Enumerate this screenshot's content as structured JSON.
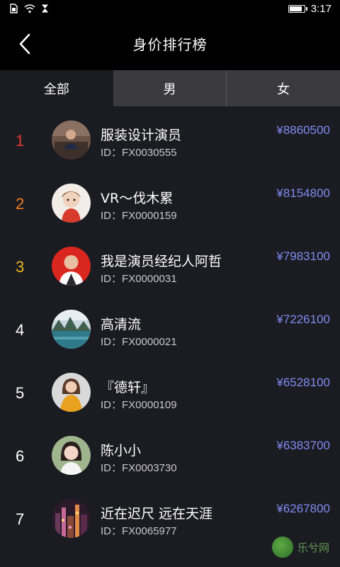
{
  "status_bar": {
    "time": "3:17"
  },
  "header": {
    "title": "身价排行榜"
  },
  "tabs": [
    {
      "label": "全部",
      "active": true
    },
    {
      "label": "男",
      "active": false
    },
    {
      "label": "女",
      "active": false
    }
  ],
  "colors": {
    "rank1": "#e23b2e",
    "rank2": "#ef7d22",
    "rank3": "#e9b520",
    "rank_default": "#ffffff",
    "price": "#7f8df0"
  },
  "list": [
    {
      "rank": "1",
      "name": "服装设计演员",
      "id": "ID：FX0030555",
      "price": "¥8860500",
      "avatar_icon": "avatar-man-at-desk"
    },
    {
      "rank": "2",
      "name": "VR～伐木累",
      "id": "ID：FX0000159",
      "price": "¥8154800",
      "avatar_icon": "avatar-cartoon-boy"
    },
    {
      "rank": "3",
      "name": "我是演员经纪人阿哲",
      "id": "ID：FX0000031",
      "price": "¥7983100",
      "avatar_icon": "avatar-man-red-background"
    },
    {
      "rank": "4",
      "name": "高清流",
      "id": "ID：FX0000021",
      "price": "¥7226100",
      "avatar_icon": "avatar-lake-landscape"
    },
    {
      "rank": "5",
      "name": "『德轩』",
      "id": "ID：FX0000109",
      "price": "¥6528100",
      "avatar_icon": "avatar-woman-yellow-top"
    },
    {
      "rank": "6",
      "name": "陈小小",
      "id": "ID：FX0003730",
      "price": "¥6383700",
      "avatar_icon": "avatar-girl-portrait"
    },
    {
      "rank": "7",
      "name": "近在迟尺  远在天涯",
      "id": "ID：FX0065977",
      "price": "¥6267800",
      "avatar_icon": "avatar-night-city"
    }
  ],
  "watermark": {
    "text": "乐兮网"
  }
}
